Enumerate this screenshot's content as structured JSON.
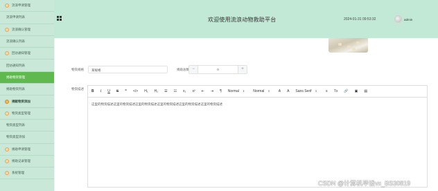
{
  "sidebar": {
    "items": [
      {
        "label": "流浪申请管理",
        "type": "parent"
      },
      {
        "label": "流浪申请列表",
        "type": "child"
      },
      {
        "label": "流浪确认管理",
        "type": "parent"
      },
      {
        "label": "流浪确认列表",
        "type": "child"
      },
      {
        "label": "回访通知管理",
        "type": "parent"
      },
      {
        "label": "回访通知列表",
        "type": "child"
      },
      {
        "label": "捐助物资管理",
        "type": "active"
      },
      {
        "label": "捐助物资列表",
        "type": "child"
      },
      {
        "label": "捐献物资添加",
        "type": "bold"
      },
      {
        "label": "物资类型管理",
        "type": "parent"
      },
      {
        "label": "物资类型列表",
        "type": "child"
      },
      {
        "label": "物资类型添加",
        "type": "child"
      },
      {
        "label": "捐助申请管理",
        "type": "parent"
      },
      {
        "label": "捐助记录管理",
        "type": "parent"
      },
      {
        "label": "系统管理",
        "type": "parent"
      }
    ]
  },
  "header": {
    "title": "欢迎使用流浪动物救助平台",
    "datetime": "2024-01-31 09:53:32",
    "username": "admin"
  },
  "form": {
    "spec_label": "物资规格",
    "spec_value": "某规格",
    "quantity_label": "捐助总数",
    "quantity_value": "0",
    "quantity_minus": "−",
    "quantity_plus": "+",
    "desc_label": "物资描述"
  },
  "editor": {
    "toolbar": {
      "bold": "B",
      "italic": "I",
      "underline": "U",
      "strike": "S",
      "quote": "❞",
      "code": "</>",
      "h1": "H₁",
      "h2": "H₂",
      "ol": "☰",
      "ul": "☷",
      "sub": "x₂",
      "sup": "x²",
      "indent_left": "⇤",
      "indent_right": "⇥",
      "rtl": "¶",
      "size_select": "Normal",
      "header_select": "Normal",
      "color": "A",
      "background": "A",
      "font_select": "Sans Serif",
      "align": "≡",
      "clean": "Tx",
      "link": "🔗",
      "image": "▣",
      "video": "▤",
      "caret": "⇕"
    },
    "content": "这里的物资描述这里的物资描述这里的物资描述这里的物资描述这里的物资描述这里的物资描述"
  },
  "watermark": "CSDN @计算机毕设vx_BS30819"
}
